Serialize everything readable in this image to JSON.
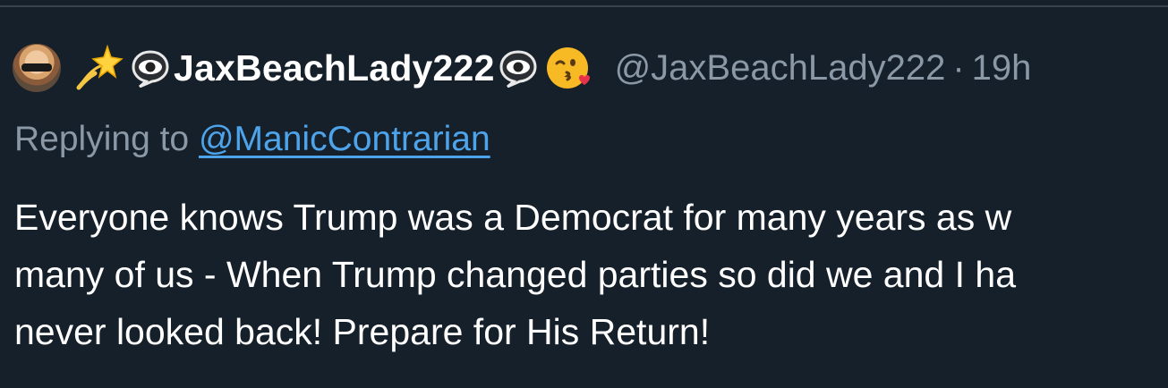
{
  "tweet": {
    "display_name": "JaxBeachLady222",
    "handle": "@JaxBeachLady222",
    "separator": "·",
    "time": "19h",
    "reply_prefix": "Replying to",
    "reply_to": "@ManicContrarian",
    "text_lines": [
      "Everyone knows Trump was a Democrat for many years as w",
      "many of us - When Trump changed parties so did we and I ha",
      "never looked back!  Prepare for His Return!"
    ],
    "icons": [
      "avatar",
      "dizzy-icon",
      "eye-in-speech-bubble-icon",
      "eye-in-speech-bubble-icon",
      "face-blowing-kiss-icon"
    ]
  }
}
